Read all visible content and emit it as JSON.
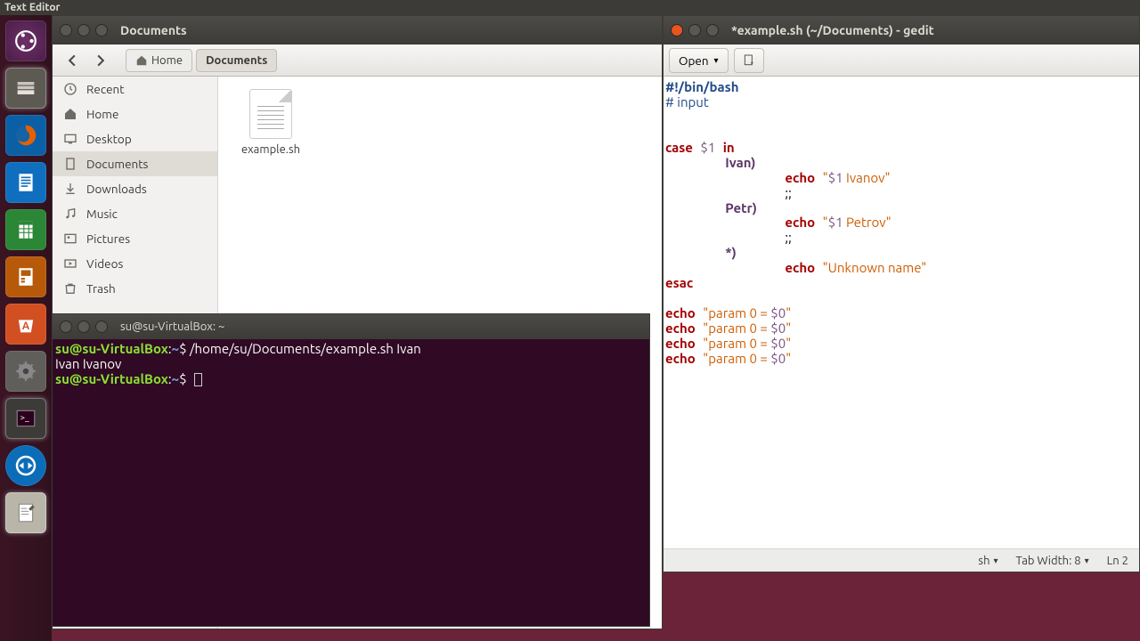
{
  "topbar": {
    "app_name": "Text Editor"
  },
  "files": {
    "title": "Documents",
    "back": "‹",
    "forward": "›",
    "home_label": "Home",
    "path_current": "Documents",
    "sidebar": [
      {
        "name": "Recent"
      },
      {
        "name": "Home"
      },
      {
        "name": "Desktop"
      },
      {
        "name": "Documents",
        "active": true
      },
      {
        "name": "Downloads"
      },
      {
        "name": "Music"
      },
      {
        "name": "Pictures"
      },
      {
        "name": "Videos"
      },
      {
        "name": "Trash"
      }
    ],
    "file": {
      "name": "example.sh"
    }
  },
  "terminal": {
    "title": "su@su-VirtualBox: ~",
    "prompt_user": "su@su-VirtualBox",
    "prompt_sep": ":",
    "prompt_path": "~",
    "prompt_dollar": "$",
    "cmd1": " /home/su/Documents/example.sh Ivan",
    "output1": "Ivan Ivanov"
  },
  "gedit": {
    "title": "*example.sh (~/Documents) - gedit",
    "open_label": "Open",
    "status": {
      "lang": "sh",
      "tabwidth_label": "Tab Width: 8",
      "line_label": "Ln 2"
    },
    "code": {
      "l1": "#!/bin/bash",
      "l2a": "# input",
      "case": "case",
      "var1": "$1",
      "in": "in",
      "ivan": "Ivan)",
      "echo": "echo",
      "str_ivanov_a": "\"",
      "str_ivanov_b": " Ivanov\"",
      "sep": ";;",
      "petr": "Petr)",
      "str_petrov_b": " Petrov\"",
      "star": "*)",
      "unknown": "\"Unknown name\"",
      "esac": "esac",
      "param_a": "\"param 0 = ",
      "var0": "$0",
      "str_close": "\""
    }
  }
}
